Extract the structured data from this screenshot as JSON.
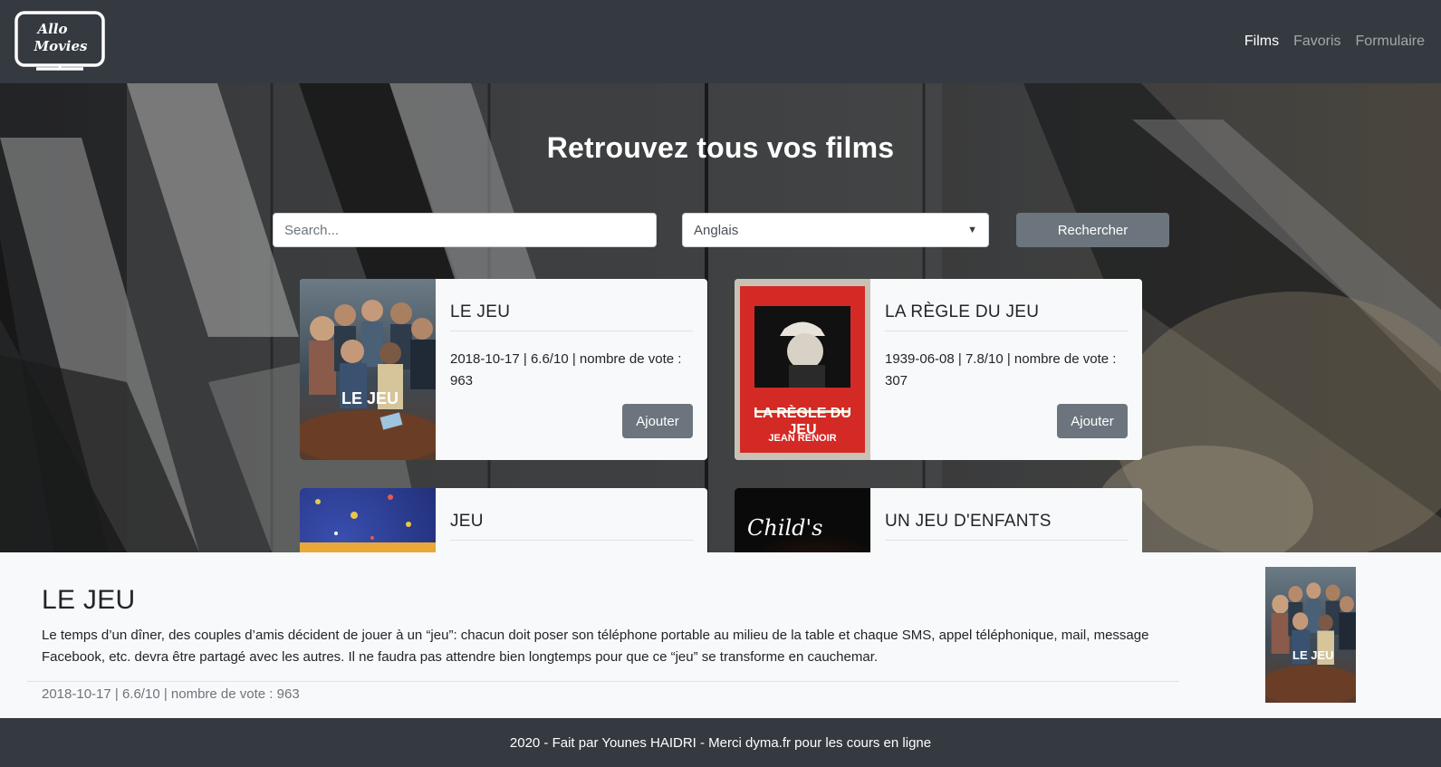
{
  "header": {
    "logo_line1": "Allo",
    "logo_line2": "Movies",
    "nav": [
      {
        "label": "Films",
        "active": true
      },
      {
        "label": "Favoris",
        "active": false
      },
      {
        "label": "Formulaire",
        "active": false
      }
    ]
  },
  "hero": {
    "title": "Retrouvez tous vos films",
    "search_placeholder": "Search...",
    "language_selected": "Anglais",
    "search_button": "Rechercher"
  },
  "cards": [
    {
      "title": "LE JEU",
      "meta": "2018-10-17 | 6.6/10 | nombre de vote : 963",
      "button": "Ajouter",
      "poster_text": "LE JEU"
    },
    {
      "title": "LA RÈGLE DU JEU",
      "meta": "1939-06-08 | 7.8/10 | nombre de vote : 307",
      "button": "Ajouter",
      "poster_text": "LA RÈGLE DU JEU",
      "poster_sub": "JEAN RENOIR"
    },
    {
      "title": "JEU",
      "meta": "",
      "button": "",
      "poster_text": ""
    },
    {
      "title": "UN JEU D'ENFANTS",
      "meta": "",
      "button": "",
      "poster_text": "Child's"
    }
  ],
  "detail": {
    "title": "LE JEU",
    "overview": "Le temps d’un dîner, des couples d’amis décident de jouer à un “jeu”: chacun doit poser son téléphone portable au milieu de la table et chaque SMS, appel téléphonique, mail, message Facebook, etc. devra être partagé avec les autres. Il ne faudra pas attendre bien longtemps pour que ce “jeu” se transforme en cauchemar.",
    "meta": "2018-10-17 | 6.6/10 | nombre de vote : 963",
    "poster_text": "LE JEU"
  },
  "footer": {
    "text": "2020 - Fait par Younes HAIDRI - Merci dyma.fr pour les cours en ligne"
  },
  "colors": {
    "navbar": "#343a40",
    "card_bg": "#f8f9fa",
    "button": "#6c757d"
  }
}
